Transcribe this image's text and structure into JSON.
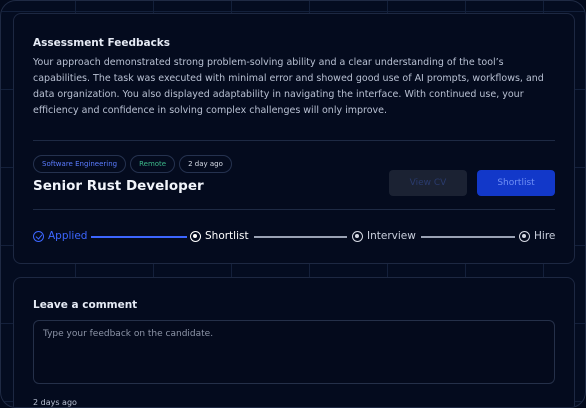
{
  "assessment": {
    "title": "Assessment Feedbacks",
    "text": "Your approach demonstrated strong problem-solving ability and a clear understanding of the tool’s capabilities. The task was executed with minimal error and showed good use of AI prompts, workflows, and data organization. You also displayed adaptability in navigating the interface. With continued use, your efficiency and confidence in solving complex challenges will only improve."
  },
  "job": {
    "tags": [
      "Software Engineering",
      "Remote",
      "2 day ago"
    ],
    "title": "Senior Rust Developer",
    "view_cv_label": "View CV",
    "shortlist_label": "Shortlist"
  },
  "stages": [
    "Applied",
    "Shortlist",
    "Interview",
    "Hire"
  ],
  "comment": {
    "title": "Leave a comment",
    "placeholder": "Type your feedback on the candidate.",
    "timestamp": "2 days ago"
  },
  "colors": {
    "accent": "#3c66ff",
    "button_primary": "#1238c9",
    "background": "#030a1c"
  }
}
